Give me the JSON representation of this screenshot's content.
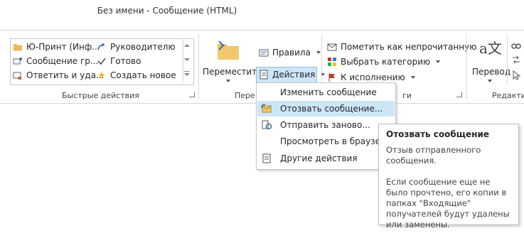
{
  "window": {
    "title": "Без имени - Сообщение (HTML)"
  },
  "quick_steps": {
    "items": [
      {
        "label": "Ю-Принт (Инф...",
        "icon": "folder-icon"
      },
      {
        "label": "Руководителю",
        "icon": "forward-arrow-icon"
      },
      {
        "label": "Сообщение гр...",
        "icon": "team-mail-icon"
      },
      {
        "label": "Готово",
        "icon": "checkmark-icon"
      },
      {
        "label": "Ответить и уда...",
        "icon": "reply-delete-icon"
      },
      {
        "label": "Создать новое",
        "icon": "lightning-icon"
      }
    ],
    "group_label": "Быстрые действия"
  },
  "move_group": {
    "move_label": "Переместить",
    "rules_label": "Правила",
    "actions_label": "Действия",
    "group_label": "Пере"
  },
  "tags_group": {
    "mark_unread": "Пометить как непрочитанную",
    "categorize": "Выбрать категорию",
    "follow_up": "К исполнению",
    "group_label": "ги"
  },
  "editing_group": {
    "translate_label": "Перевод",
    "group_label": "Редактир"
  },
  "actions_menu": {
    "items": [
      {
        "label": "Изменить сообщение",
        "icon": ""
      },
      {
        "label": "Отозвать сообщение...",
        "icon": "recall-icon"
      },
      {
        "label": "Отправить заново...",
        "icon": "resend-icon"
      },
      {
        "label": "Просмотреть в браузере",
        "icon": ""
      },
      {
        "label": "Другие действия",
        "icon": "other-actions-icon"
      }
    ]
  },
  "tooltip": {
    "title": "Отозвать сообщение",
    "text": "Отзыв отправленного сообщения.\n\nЕсли сообщение еще не было прочтено, его копии в папках \"Входящие\" получателей будут удалены или заменены."
  },
  "colors": {
    "highlight": "#cde6f7",
    "highlight_border": "#92c0e0",
    "flag_red": "#c0392b"
  }
}
